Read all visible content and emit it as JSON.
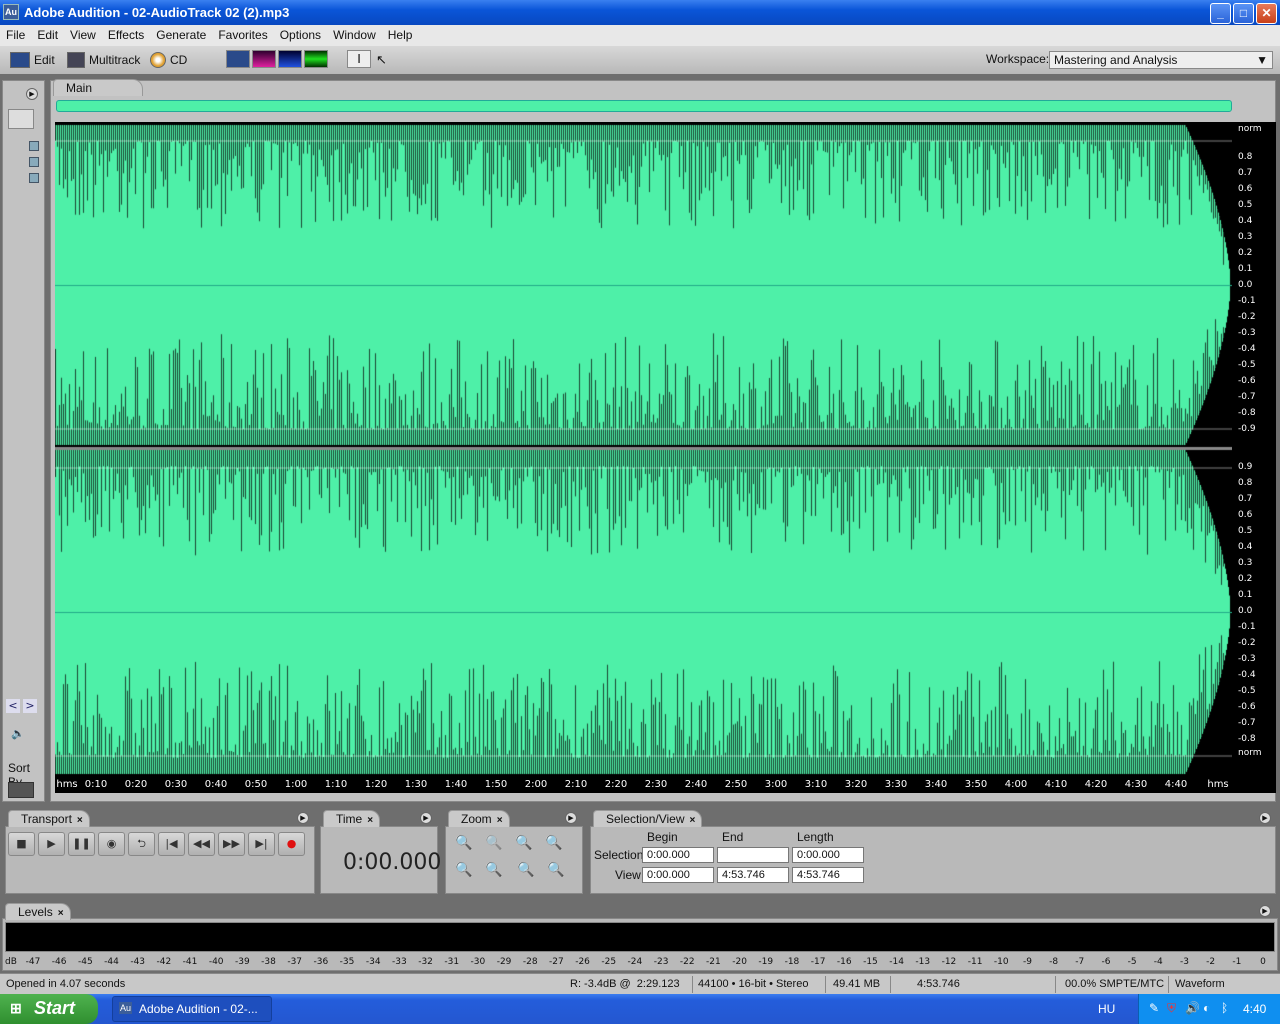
{
  "window": {
    "title": "Adobe Audition - 02-AudioTrack 02 (2).mp3",
    "app_icon": "Au",
    "minimize": "_",
    "maximize": "□",
    "close": "✕"
  },
  "menu": [
    "File",
    "Edit",
    "View",
    "Effects",
    "Generate",
    "Favorites",
    "Options",
    "Window",
    "Help"
  ],
  "toolbar": {
    "edit": "Edit",
    "multitrack": "Multitrack",
    "cd": "CD",
    "workspace_label": "Workspace:",
    "workspace_value": "Mastering and Analysis"
  },
  "main": {
    "tab": "Main",
    "side_label": "Sort By",
    "amp_ch1": [
      "norm",
      "0.8",
      "0.7",
      "0.6",
      "0.5",
      "0.4",
      "0.3",
      "0.2",
      "0.1",
      "0.0",
      "-0.1",
      "-0.2",
      "-0.3",
      "-0.4",
      "-0.5",
      "-0.6",
      "-0.7",
      "-0.8",
      "-0.9"
    ],
    "amp_ch2": [
      "0.9",
      "0.8",
      "0.7",
      "0.6",
      "0.5",
      "0.4",
      "0.3",
      "0.2",
      "0.1",
      "0.0",
      "-0.1",
      "-0.2",
      "-0.3",
      "-0.4",
      "-0.5",
      "-0.6",
      "-0.7",
      "-0.8",
      "norm"
    ],
    "time_ticks": [
      "hms",
      "0:10",
      "0:20",
      "0:30",
      "0:40",
      "0:50",
      "1:00",
      "1:10",
      "1:20",
      "1:30",
      "1:40",
      "1:50",
      "2:00",
      "2:10",
      "2:20",
      "2:30",
      "2:40",
      "2:50",
      "3:00",
      "3:10",
      "3:20",
      "3:30",
      "3:40",
      "3:50",
      "4:00",
      "4:10",
      "4:20",
      "4:30",
      "4:40",
      "hms"
    ],
    "wave_color": "#4ef0a8"
  },
  "transport": {
    "title": "Transport"
  },
  "time": {
    "title": "Time",
    "value": "0:00.000"
  },
  "zoom": {
    "title": "Zoom"
  },
  "selection": {
    "title": "Selection/View",
    "begin": "Begin",
    "end": "End",
    "length": "Length",
    "selection_label": "Selection",
    "view_label": "View",
    "sel_begin": "0:00.000",
    "sel_end": "",
    "sel_length": "0:00.000",
    "view_begin": "0:00.000",
    "view_end": "4:53.746",
    "view_length": "4:53.746"
  },
  "levels": {
    "title": "Levels",
    "scale": [
      "dB",
      "-47",
      "-46",
      "-45",
      "-44",
      "-43",
      "-42",
      "-41",
      "-40",
      "-39",
      "-38",
      "-37",
      "-36",
      "-35",
      "-34",
      "-33",
      "-32",
      "-31",
      "-30",
      "-29",
      "-28",
      "-27",
      "-26",
      "-25",
      "-24",
      "-23",
      "-22",
      "-21",
      "-20",
      "-19",
      "-18",
      "-17",
      "-16",
      "-15",
      "-14",
      "-13",
      "-12",
      "-11",
      "-10",
      "-9",
      "-8",
      "-7",
      "-6",
      "-5",
      "-4",
      "-3",
      "-2",
      "-1",
      "0"
    ]
  },
  "status": {
    "message": "Opened in 4.07 seconds",
    "cursor": "R: -3.4dB @  2:29.123",
    "format": "44100 • 16-bit • Stereo",
    "size": "49.41 MB",
    "duration": "4:53.746",
    "sync": "00.0% SMPTE/MTC",
    "view": "Waveform"
  },
  "taskbar": {
    "start": "Start",
    "task": "Adobe Audition - 02-...",
    "lang": "HU",
    "clock": "4:40"
  }
}
